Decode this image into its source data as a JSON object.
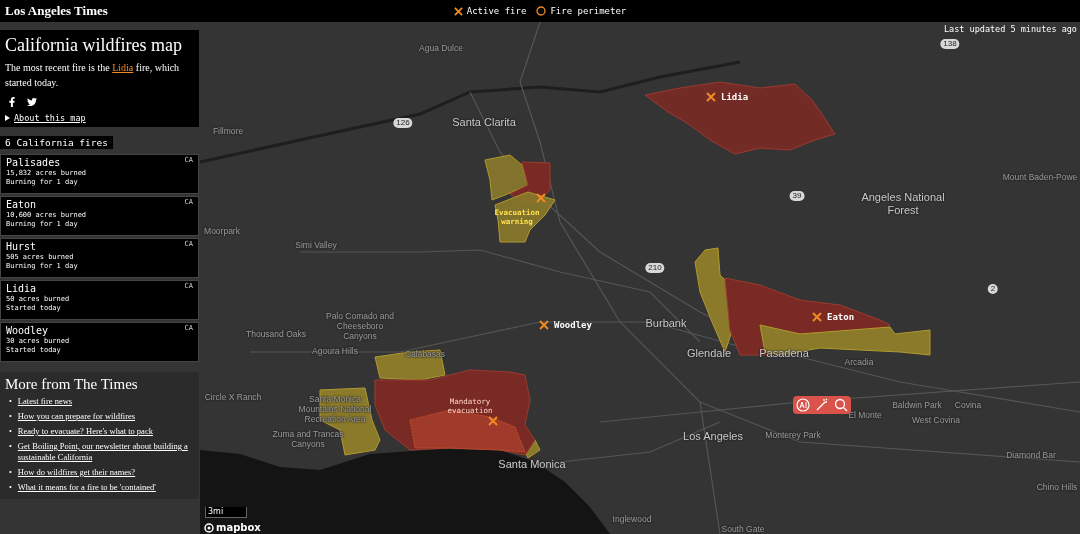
{
  "header": {
    "logo": "Los Angeles Times",
    "legend": [
      {
        "kind": "active",
        "label": "Active fire"
      },
      {
        "kind": "perimeter",
        "label": "Fire perimeter"
      }
    ]
  },
  "intro": {
    "title": "California wildfires map",
    "text_before": "The most recent fire is the",
    "link": "Lidia",
    "text_after": "fire, which started today.",
    "about": "About this map"
  },
  "count_label": "6 California fires",
  "fires": [
    {
      "name": "Palisades",
      "acres": "15,832 acres burned",
      "status": "Burning for 1 day",
      "state": "CA"
    },
    {
      "name": "Eaton",
      "acres": "10,600 acres burned",
      "status": "Burning for 1 day",
      "state": "CA"
    },
    {
      "name": "Hurst",
      "acres": "505 acres burned",
      "status": "Burning for 1 day",
      "state": "CA"
    },
    {
      "name": "Lidia",
      "acres": "50 acres burned",
      "status": "Started today",
      "state": "CA"
    },
    {
      "name": "Woodley",
      "acres": "30 acres burned",
      "status": "Started today",
      "state": "CA"
    }
  ],
  "more": {
    "title": "More from The Times",
    "bullet": "•",
    "links": [
      "Latest fire news",
      "How you can prepare for wildfires",
      "Ready to evacuate? Here's what to pack",
      "Get Boiling Point, our newsletter about building a sustainable California",
      "How do wildfires get their names?",
      "What it means for a fire to be 'contained'"
    ]
  },
  "map": {
    "last_updated": "Last updated 5 minutes ago",
    "places": [
      "Agua Dulce",
      "Fillmore",
      "Santa Clarita",
      "Moorpark",
      "Simi Valley",
      "Angeles National Forest",
      "Mount Baden-Powe",
      "Thousand Oaks",
      "Palo Comado and Cheeseboro Canyons",
      "Agoura Hills",
      "Calabasas",
      "Burbank",
      "Glendale",
      "Pasadena",
      "Arcadia",
      "Circle X Ranch",
      "Santa Monica Mountains National Recreation Area",
      "Zuma and Trancas Canyons",
      "Los Angeles",
      "Monterey Park",
      "El Monte",
      "Baldwin Park",
      "Covina",
      "West Covina",
      "Diamond Bar",
      "Chino Hills",
      "Santa Monica",
      "Inglewood",
      "South Gate"
    ],
    "highways": [
      "126",
      "138",
      "2",
      "210",
      "39"
    ],
    "fire_labels": [
      "Lidia",
      "Woodley",
      "Eaton"
    ],
    "zones": [
      {
        "kind": "warning",
        "label": "Evacuation warning"
      },
      {
        "kind": "mandatory",
        "label": "Mandatory evacuation"
      }
    ],
    "scale": "3mi",
    "attribution": "mapbox"
  }
}
